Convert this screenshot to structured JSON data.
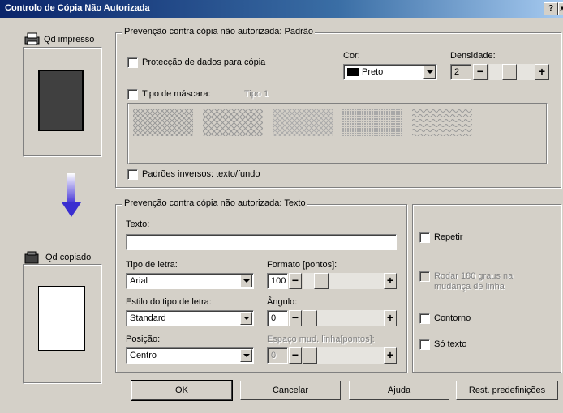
{
  "window": {
    "title": "Controlo de Cópia Não Autorizada",
    "help_btn": "?",
    "close_btn": "x"
  },
  "left": {
    "printed_label": "Qd impresso",
    "copied_label": "Qd copiado"
  },
  "standard": {
    "legend": "Prevenção contra cópia não autorizada: Padrão",
    "data_protection_label": "Protecção de dados para cópia",
    "color_label": "Cor:",
    "color_value": "Preto",
    "density_label": "Densidade:",
    "density_value": "2",
    "mask_type_label": "Tipo de máscara:",
    "mask_type_value": "Tipo 1",
    "inverse_label": "Padrões inversos: texto/fundo"
  },
  "text_section": {
    "legend": "Prevenção contra cópia não autorizada: Texto",
    "text_label": "Texto:",
    "text_value": "",
    "font_label": "Tipo de letra:",
    "font_value": "Arial",
    "format_label": "Formato [pontos]:",
    "format_value": "100",
    "style_label": "Estilo do tipo de letra:",
    "style_value": "Standard",
    "angle_label": "Ângulo:",
    "angle_value": "0",
    "position_label": "Posição:",
    "position_value": "Centro",
    "line_spacing_label": "Espaço mud. linha[pontos]:",
    "line_spacing_value": "0",
    "repeat_label": "Repetir",
    "rotate_label": "Rodar 180 graus na mudança de linha",
    "outline_label": "Contorno",
    "text_only_label": "Só texto"
  },
  "buttons": {
    "ok": "OK",
    "cancel": "Cancelar",
    "help": "Ajuda",
    "reset": "Rest. predefinições"
  },
  "spin": {
    "minus": "−",
    "plus": "+"
  }
}
